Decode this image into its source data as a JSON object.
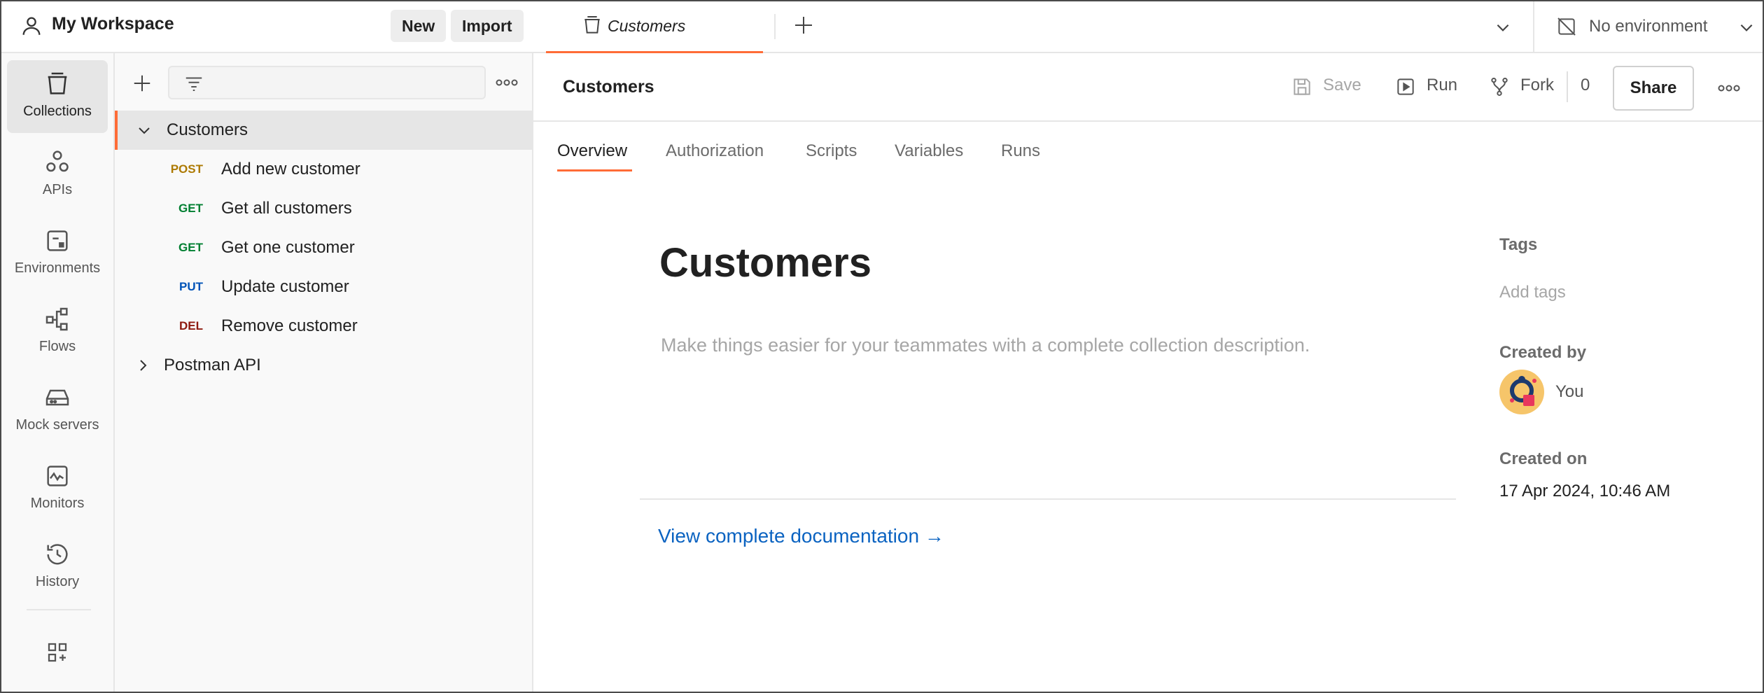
{
  "workspace": {
    "name": "My Workspace",
    "new_label": "New",
    "import_label": "Import"
  },
  "rail": {
    "items": [
      {
        "label": "Collections",
        "icon": "collections-icon",
        "active": true
      },
      {
        "label": "APIs",
        "icon": "apis-icon"
      },
      {
        "label": "Environments",
        "icon": "environments-icon"
      },
      {
        "label": "Flows",
        "icon": "flows-icon"
      },
      {
        "label": "Mock servers",
        "icon": "mock-servers-icon"
      },
      {
        "label": "Monitors",
        "icon": "monitors-icon"
      },
      {
        "label": "History",
        "icon": "history-icon"
      }
    ]
  },
  "tree": {
    "collection": "Customers",
    "requests": [
      {
        "method": "POST",
        "name": "Add new customer"
      },
      {
        "method": "GET",
        "name": "Get all customers"
      },
      {
        "method": "GET",
        "name": "Get one customer"
      },
      {
        "method": "PUT",
        "name": "Update customer"
      },
      {
        "method": "DEL",
        "name": "Remove customer"
      }
    ],
    "other_collection": "Postman API"
  },
  "tabbar": {
    "active_tab": "Customers",
    "environment": "No environment"
  },
  "header": {
    "title": "Customers",
    "save": "Save",
    "run": "Run",
    "fork": "Fork",
    "fork_count": "0",
    "share": "Share"
  },
  "subtabs": [
    "Overview",
    "Authorization",
    "Scripts",
    "Variables",
    "Runs"
  ],
  "overview": {
    "title": "Customers",
    "description_placeholder": "Make things easier for your teammates with a complete collection description.",
    "doc_link": "View complete documentation →"
  },
  "meta": {
    "tags_label": "Tags",
    "add_tags": "Add tags",
    "created_by_label": "Created by",
    "created_by": "You",
    "created_on_label": "Created on",
    "created_on": "17 Apr 2024, 10:46 AM"
  },
  "colors": {
    "accent": "#ff6c37",
    "link": "#0b63c1",
    "post": "#ad7a03",
    "get": "#007f31",
    "put": "#0053b8",
    "del": "#8e1a10"
  }
}
